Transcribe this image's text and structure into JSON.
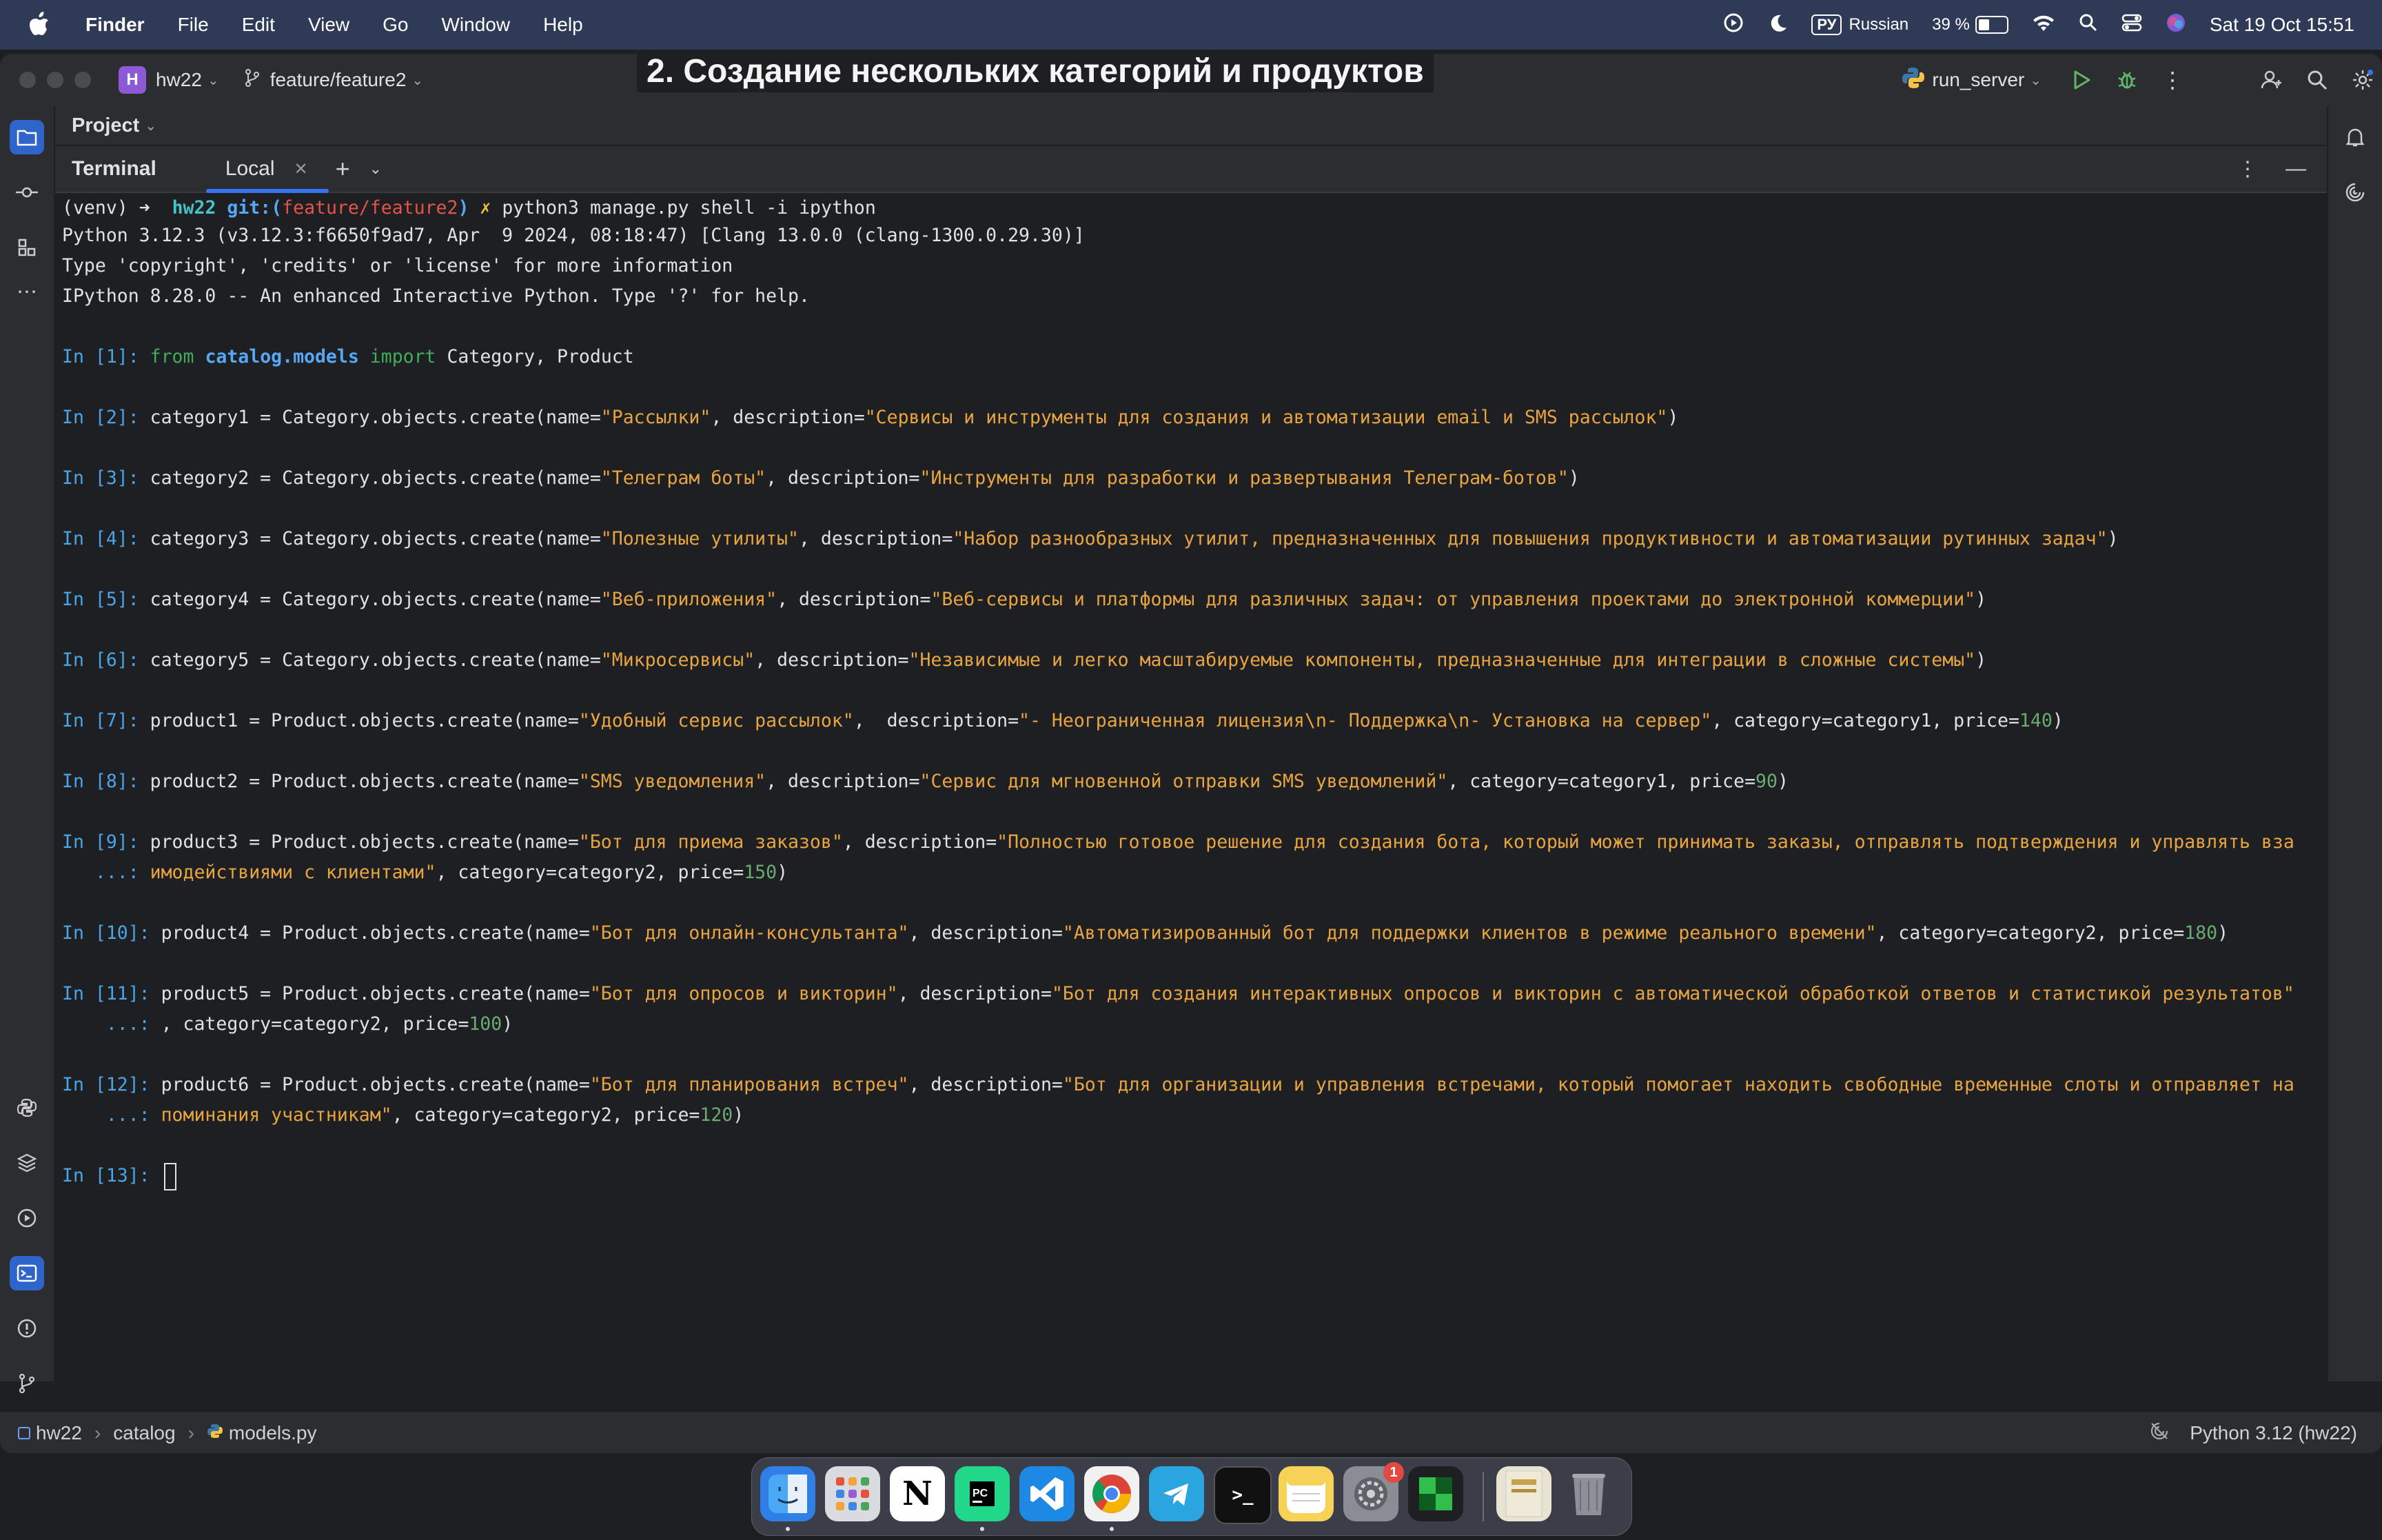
{
  "menubar": {
    "app": "Finder",
    "items": [
      "File",
      "Edit",
      "View",
      "Go",
      "Window",
      "Help"
    ],
    "keyboard_badge": "РУ",
    "keyboard_layout": "Russian",
    "battery": "39 %",
    "battery_level": 0.39,
    "datetime": "Sat 19 Oct  15:51"
  },
  "titlebar": {
    "project_badge": "H",
    "project_name": "hw22",
    "branch": "feature/feature2",
    "run_config": "run_server"
  },
  "project_panel": {
    "label": "Project"
  },
  "overlay_title": "2. Создание нескольких категорий и продуктов",
  "terminal": {
    "label": "Terminal",
    "tab": "Local",
    "prompt": {
      "venv": "(venv)",
      "arrow": "➜",
      "dir": "hw22",
      "git_prefix": "git:(",
      "branch": "feature/feature2",
      "git_suffix": ")",
      "mark": "✗",
      "command": "python3 manage.py shell -i ipython"
    },
    "banner": [
      "Python 3.12.3 (v3.12.3:f6650f9ad7, Apr  9 2024, 08:18:47) [Clang 13.0.0 (clang-1300.0.29.30)]",
      "Type 'copyright', 'credits' or 'license' for more information",
      "IPython 8.28.0 -- An enhanced Interactive Python. Type '?' for help."
    ],
    "in1": {
      "prompt": "In [1]: ",
      "from": "from",
      "module": "catalog.models",
      "import": "import",
      "names": " Category, Product"
    },
    "cells": [
      {
        "prompt": "In [2]: ",
        "pre": "category1 = Category.objects.create(name=",
        "name": "\"Рассылки\"",
        "mid": ", description=",
        "desc": "\"Сервисы и инструменты для создания и автоматизации email и SMS рассылок\"",
        "post": ")"
      },
      {
        "prompt": "In [3]: ",
        "pre": "category2 = Category.objects.create(name=",
        "name": "\"Телеграм боты\"",
        "mid": ", description=",
        "desc": "\"Инструменты для разработки и развертывания Телеграм-ботов\"",
        "post": ")"
      },
      {
        "prompt": "In [4]: ",
        "pre": "category3 = Category.objects.create(name=",
        "name": "\"Полезные утилиты\"",
        "mid": ", description=",
        "desc": "\"Набор разнообразных утилит, предназначенных для повышения продуктивности и автоматизации рутинных задач\"",
        "post": ")"
      },
      {
        "prompt": "In [5]: ",
        "pre": "category4 = Category.objects.create(name=",
        "name": "\"Веб-приложения\"",
        "mid": ", description=",
        "desc": "\"Веб-сервисы и платформы для различных задач: от управления проектами до электронной коммерции\"",
        "post": ")"
      },
      {
        "prompt": "In [6]: ",
        "pre": "category5 = Category.objects.create(name=",
        "name": "\"Микросервисы\"",
        "mid": ", description=",
        "desc": "\"Независимые и легко масштабируемые компоненты, предназначенные для интеграции в сложные системы\"",
        "post": ")"
      }
    ],
    "in7": {
      "prompt": "In [7]: ",
      "pre": "product1 = Product.objects.create(name=",
      "name": "\"Удобный сервис рассылок\"",
      "mid": ",  description=",
      "desc": "\"- Неограниченная лицензия\\n- Поддержка\\n- Установка на сервер\"",
      "post1": ", category=category1, price=",
      "price": "140",
      "post2": ")"
    },
    "in8": {
      "prompt": "In [8]: ",
      "pre": "product2 = Product.objects.create(name=",
      "name": "\"SMS уведомления\"",
      "mid": ", description=",
      "desc": "\"Сервис для мгновенной отправки SMS уведомлений\"",
      "post1": ", category=category1, price=",
      "price": "90",
      "post2": ")"
    },
    "in9": {
      "prompt": "In [9]: ",
      "pre": "product3 = Product.objects.create(name=",
      "name": "\"Бот для приема заказов\"",
      "mid": ", description=",
      "desc": "\"Полностью готовое решение для создания бота, который может принимать заказы, отправлять подтверждения и управлять вза",
      "cont": "   ...: ",
      "desc2": "имодействиями с клиентами\"",
      "post1": ", category=category2, price=",
      "price": "150",
      "post2": ")"
    },
    "in10": {
      "prompt": "In [10]: ",
      "pre": "product4 = Product.objects.create(name=",
      "name": "\"Бот для онлайн-консультанта\"",
      "mid": ", description=",
      "desc": "\"Автоматизированный бот для поддержки клиентов в режиме реального времени\"",
      "post1": ", category=category2, price=",
      "price": "180",
      "post2": ")"
    },
    "in11": {
      "prompt": "In [11]: ",
      "pre": "product5 = Product.objects.create(name=",
      "name": "\"Бот для опросов и викторин\"",
      "mid": ", description=",
      "desc": "\"Бот для создания интерактивных опросов и викторин с автоматической обработкой ответов и статистикой результатов\"",
      "cont": "    ...: ",
      "post1": ", category=category2, price=",
      "price": "100",
      "post2": ")"
    },
    "in12": {
      "prompt": "In [12]: ",
      "pre": "product6 = Product.objects.create(name=",
      "name": "\"Бот для планирования встреч\"",
      "mid": ", description=",
      "desc": "\"Бот для организации и управления встречами, который помогает находить свободные временные слоты и отправляет на",
      "cont": "    ...: ",
      "desc2": "поминания участникам\"",
      "post1": ", category=category2, price=",
      "price": "120",
      "post2": ")"
    },
    "in13": {
      "prompt": "In [13]: "
    }
  },
  "statusbar": {
    "breadcrumb": [
      "hw22",
      "catalog",
      "models.py"
    ],
    "interpreter": "Python 3.12 (hw22)"
  },
  "dock": {
    "apps": [
      "Finder",
      "Launchpad",
      "Notion",
      "PyCharm",
      "VS Code",
      "Chrome",
      "Telegram",
      "Terminal",
      "Notes",
      "System Settings",
      "App",
      "Book",
      "Trash"
    ],
    "settings_badge": "1",
    "colors": {
      "finder": "#2f7fe6",
      "pycharm": "#21d789",
      "vscode": "#1e88e5",
      "telegram": "#2aa5e0"
    }
  }
}
